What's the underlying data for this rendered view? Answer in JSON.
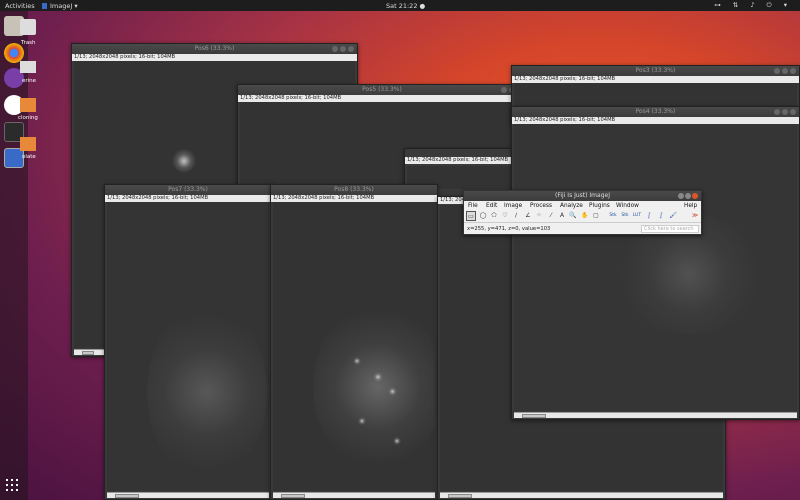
{
  "topbar": {
    "activities": "Activities",
    "app_name": "ImageJ",
    "app_caret": "▾",
    "clock": "Sat 21:22 ●",
    "sys_icons": "⊶ ⇅ ♪ ⏻ ▾"
  },
  "desktop": {
    "trash": "Trash",
    "erine": "erine",
    "cloning": "cloning",
    "olate": "olate"
  },
  "image_info": "1/13; 2048x2048 pixels; 16-bit; 104MB",
  "windows": {
    "pos6": "Pos6 (33.3%)",
    "pos5": "Pos5 (33.3%)",
    "pos3": "Pos3 (33.3%)",
    "pos4": "Pos4 (33.3%)",
    "pos7": "Pos7 (33.3%)",
    "pos8": "Pos8 (33.3%)"
  },
  "imagej": {
    "title": "(Fiji Is Just) ImageJ",
    "menus": [
      "File",
      "Edit",
      "Image",
      "Process",
      "Analyze",
      "Plugins",
      "Window",
      "Help"
    ],
    "status": "x=255, y=471, z=0, value=103",
    "search_placeholder": "Click here to search",
    "tools": [
      "▭",
      "◯",
      "⬠",
      "♡",
      "∕",
      "∠",
      "⁘",
      "A",
      "🔍",
      "✋",
      "▢",
      "Stk",
      "Stk",
      "LUT",
      "∫",
      "∫",
      "🖌",
      "≫"
    ]
  }
}
